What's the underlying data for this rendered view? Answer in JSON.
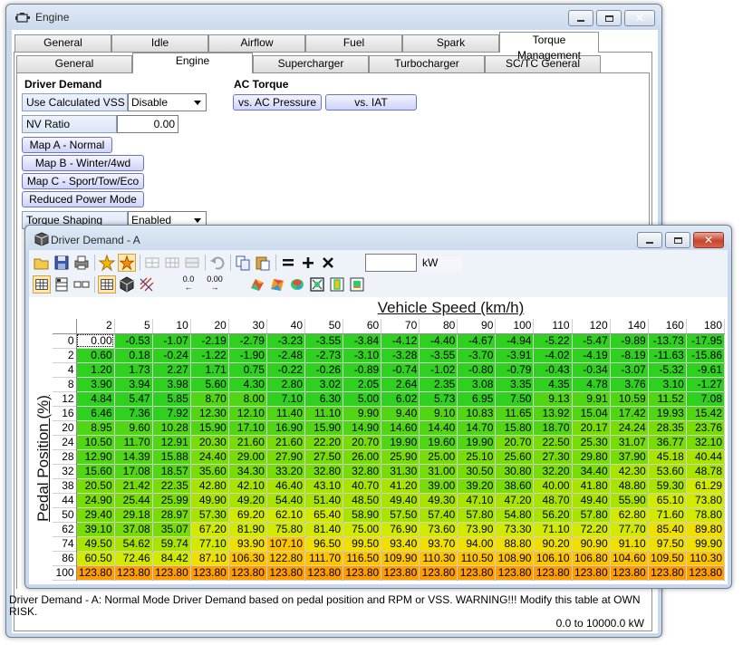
{
  "main_window": {
    "title": "Engine",
    "top_tabs": [
      "General",
      "Idle",
      "Airflow",
      "Fuel",
      "Spark",
      "Torque Management"
    ],
    "active_top_tab": 5,
    "sub_tabs": [
      "General",
      "Engine",
      "Supercharger",
      "Turbocharger",
      "SC/TC General"
    ],
    "active_sub_tab": 1,
    "driver_demand": {
      "title": "Driver Demand",
      "use_calc_vss_label": "Use Calculated VSS",
      "use_calc_vss_value": "Disable",
      "nv_ratio_label": "NV Ratio",
      "nv_ratio_value": "0.00",
      "map_a": "Map A - Normal",
      "map_b": "Map B - Winter/4wd",
      "map_c": "Map C - Sport/Tow/Eco",
      "reduced_power": "Reduced Power Mode",
      "torque_shaping_label": "Torque Shaping",
      "torque_shaping_value": "Enabled"
    },
    "ac_torque": {
      "title": "AC Torque",
      "vs_ac_pressure": "vs. AC Pressure",
      "vs_iat": "vs. IAT"
    },
    "description": "Driver Demand - A: Normal Mode Driver Demand based on pedal position and RPM or VSS. WARNING!!! Modify this table at OWN RISK.",
    "range": "0.0 to 10000.0 kW"
  },
  "table_window": {
    "title": "Driver Demand - A",
    "unit_value": "",
    "unit_label": "kW",
    "x_axis_title": "Vehicle Speed (km/h)",
    "y_axis_title": "Pedal Position (%)",
    "icons": {
      "toolbar1": [
        "open-icon",
        "save-icon",
        "print-icon",
        "star-icon",
        "star-burst-icon",
        "grid-copy-icon",
        "grid-paste-icon",
        "grid-fill-icon",
        "undo-icon",
        "copy-icon",
        "paste-icon",
        "equals-icon",
        "plus-icon",
        "multiply-icon"
      ],
      "toolbar2": [
        "table-view-icon",
        "table-edit-icon",
        "column-view-icon",
        "grid-view-icon",
        "cube-3d-icon",
        "hatch-icon",
        "decimal-left-icon",
        "decimal-right-icon",
        "surface-plot-icon",
        "surface-plot-alt-icon",
        "surface-plot-color-icon",
        "zoom-fit-icon",
        "color-bar-icon",
        "gradient-icon"
      ]
    },
    "decimal_left_label": "0.0",
    "decimal_right_label": "0.00",
    "colors": {
      "low": "#3dd420",
      "mid": "#c8e800",
      "high": "#ffb000",
      "max": "#ff9a00"
    },
    "selected_cell": [
      0,
      0
    ],
    "x": [
      2,
      5,
      10,
      20,
      30,
      40,
      50,
      60,
      70,
      80,
      90,
      100,
      110,
      120,
      140,
      160,
      180
    ],
    "y": [
      0,
      2,
      4,
      8,
      12,
      16,
      20,
      24,
      28,
      32,
      38,
      44,
      50,
      62,
      74,
      86,
      100
    ],
    "values": [
      [
        "0.00",
        "-0.53",
        "-1.07",
        "-2.19",
        "-2.79",
        "-3.23",
        "-3.55",
        "-3.84",
        "-4.12",
        "-4.40",
        "-4.67",
        "-4.94",
        "-5.22",
        "-5.47",
        "-9.89",
        "-13.73",
        "-17.95"
      ],
      [
        "0.60",
        "0.18",
        "-0.24",
        "-1.22",
        "-1.90",
        "-2.48",
        "-2.73",
        "-3.10",
        "-3.28",
        "-3.55",
        "-3.70",
        "-3.91",
        "-4.02",
        "-4.19",
        "-8.19",
        "-11.63",
        "-15.86"
      ],
      [
        "1.20",
        "1.73",
        "2.27",
        "1.71",
        "0.75",
        "-0.22",
        "-0.26",
        "-0.89",
        "-0.74",
        "-1.02",
        "-0.80",
        "-0.79",
        "-0.43",
        "-0.34",
        "-3.07",
        "-5.32",
        "-9.61"
      ],
      [
        "3.90",
        "3.94",
        "3.98",
        "5.60",
        "4.30",
        "2.80",
        "3.02",
        "2.05",
        "2.64",
        "2.35",
        "3.08",
        "3.35",
        "4.35",
        "4.78",
        "3.76",
        "3.10",
        "-1.27"
      ],
      [
        "4.84",
        "5.47",
        "5.85",
        "8.70",
        "8.00",
        "7.10",
        "6.30",
        "5.00",
        "6.02",
        "5.73",
        "6.95",
        "7.50",
        "9.13",
        "9.91",
        "10.59",
        "11.52",
        "7.08"
      ],
      [
        "6.46",
        "7.36",
        "7.92",
        "12.30",
        "12.10",
        "11.40",
        "11.10",
        "9.90",
        "9.40",
        "9.10",
        "10.83",
        "11.65",
        "13.92",
        "15.04",
        "17.42",
        "19.93",
        "15.42"
      ],
      [
        "8.95",
        "9.60",
        "10.28",
        "15.90",
        "17.10",
        "16.90",
        "15.90",
        "14.90",
        "14.60",
        "14.40",
        "14.70",
        "15.80",
        "18.70",
        "20.17",
        "24.24",
        "28.35",
        "23.76"
      ],
      [
        "10.50",
        "11.70",
        "12.91",
        "20.30",
        "21.60",
        "21.60",
        "22.20",
        "20.70",
        "19.90",
        "19.60",
        "19.90",
        "20.70",
        "22.50",
        "25.30",
        "31.07",
        "36.77",
        "32.10"
      ],
      [
        "12.90",
        "14.39",
        "15.88",
        "24.40",
        "29.00",
        "27.90",
        "27.50",
        "26.00",
        "25.90",
        "25.00",
        "25.10",
        "25.60",
        "27.30",
        "29.80",
        "37.90",
        "45.18",
        "40.44"
      ],
      [
        "15.60",
        "17.08",
        "18.57",
        "35.60",
        "34.30",
        "33.20",
        "32.80",
        "32.80",
        "31.30",
        "31.00",
        "30.50",
        "30.80",
        "32.20",
        "34.40",
        "42.30",
        "53.60",
        "48.78"
      ],
      [
        "20.50",
        "21.42",
        "22.35",
        "42.80",
        "42.10",
        "46.40",
        "43.10",
        "40.70",
        "41.20",
        "39.00",
        "39.20",
        "38.60",
        "40.00",
        "41.80",
        "48.80",
        "59.30",
        "61.29"
      ],
      [
        "24.90",
        "25.44",
        "25.99",
        "49.90",
        "49.20",
        "54.40",
        "51.40",
        "48.50",
        "49.40",
        "49.30",
        "47.10",
        "47.20",
        "48.70",
        "49.40",
        "55.90",
        "65.10",
        "73.80"
      ],
      [
        "29.40",
        "29.18",
        "28.97",
        "57.30",
        "69.20",
        "62.10",
        "65.40",
        "58.90",
        "57.50",
        "57.40",
        "57.80",
        "54.80",
        "56.20",
        "57.80",
        "62.80",
        "71.60",
        "78.80"
      ],
      [
        "39.10",
        "37.08",
        "35.07",
        "67.20",
        "81.90",
        "75.80",
        "81.40",
        "75.00",
        "76.90",
        "73.60",
        "73.90",
        "73.30",
        "71.10",
        "72.20",
        "77.70",
        "85.40",
        "89.80"
      ],
      [
        "49.50",
        "54.62",
        "59.74",
        "77.10",
        "93.90",
        "107.10",
        "96.50",
        "99.50",
        "93.40",
        "93.70",
        "94.00",
        "88.80",
        "90.20",
        "90.90",
        "91.10",
        "97.50",
        "99.90"
      ],
      [
        "60.50",
        "72.46",
        "84.42",
        "87.10",
        "106.30",
        "122.80",
        "111.70",
        "116.50",
        "109.90",
        "110.30",
        "110.50",
        "108.90",
        "106.10",
        "106.80",
        "104.60",
        "109.50",
        "110.30"
      ],
      [
        "123.80",
        "123.80",
        "123.80",
        "123.80",
        "123.80",
        "123.80",
        "123.80",
        "123.80",
        "123.80",
        "123.80",
        "123.80",
        "123.80",
        "123.80",
        "123.80",
        "123.80",
        "123.80",
        "123.80"
      ]
    ]
  }
}
